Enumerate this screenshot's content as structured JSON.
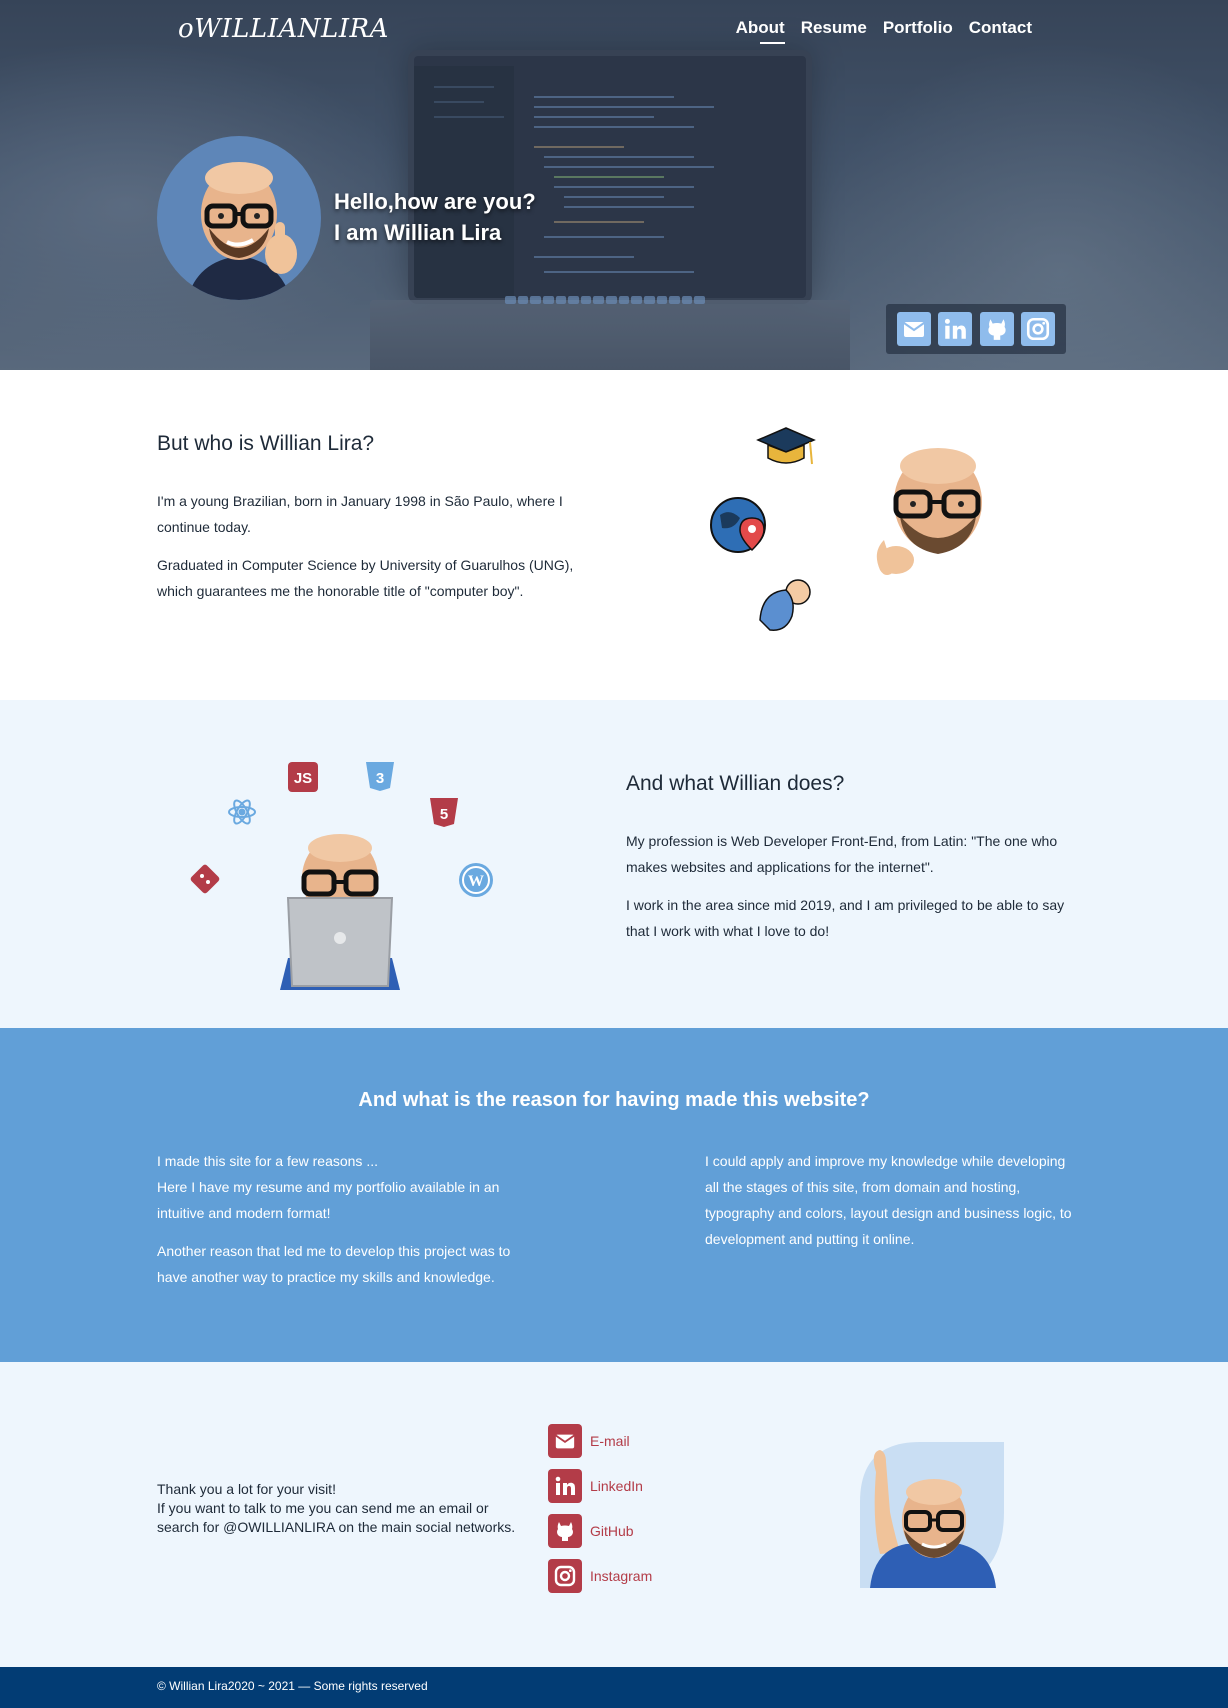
{
  "nav": {
    "logo": "oWILLIANLIRA",
    "links": [
      "About",
      "Resume",
      "Portfolio",
      "Contact"
    ]
  },
  "hero": {
    "line1": "Hello,how are you?",
    "line2": "I am Willian Lira",
    "social_icons": [
      "email-icon",
      "linkedin-icon",
      "github-icon",
      "instagram-icon"
    ]
  },
  "about": {
    "title": "But who is Willian Lira?",
    "p1": "I'm a young Brazilian, born in January 1998 in São Paulo, where I continue today.",
    "p2": "Graduated in Computer Science by University of Guarulhos (UNG), which guarantees me the honorable title of \"computer boy\"."
  },
  "work": {
    "title": "And what Willian does?",
    "p1": "My profession is Web Developer Front-End, from Latin: \"The one who makes websites and applications for the internet\".",
    "p2": "I work in the area since mid 2019, and I am privileged to be able to say that I work with what I love to do!",
    "tech_badges": {
      "js": "JS",
      "css": "3",
      "html": "5"
    }
  },
  "reason": {
    "title": "And what is the reason for having made this website?",
    "left_p1_l1": "I made this site for a few reasons ...",
    "left_p1_l2": "Here I have my resume and my portfolio available in an intuitive and modern format!",
    "left_p2": "Another reason that led me to develop this project was to have another way to practice my skills and knowledge.",
    "right_p1": "I could apply and improve my knowledge while developing all the stages of this site, from domain and hosting, typography and colors, layout design and business logic, to development and putting it online."
  },
  "contact": {
    "l1": "Thank you a lot for your visit!",
    "l2": "If you want to talk to me you can send me an email or search for @OWILLIANLIRA on the main social networks.",
    "links": [
      "E-mail",
      "LinkedIn",
      "GitHub",
      "Instagram"
    ]
  },
  "footer": {
    "text": "© Willian Lira2020 ~ 2021 — Some rights reserved"
  },
  "colors": {
    "accent_blue": "#619fd7",
    "light_bg": "#eef6fd",
    "contact_red": "#b33c48",
    "footer_navy": "#023c74"
  }
}
